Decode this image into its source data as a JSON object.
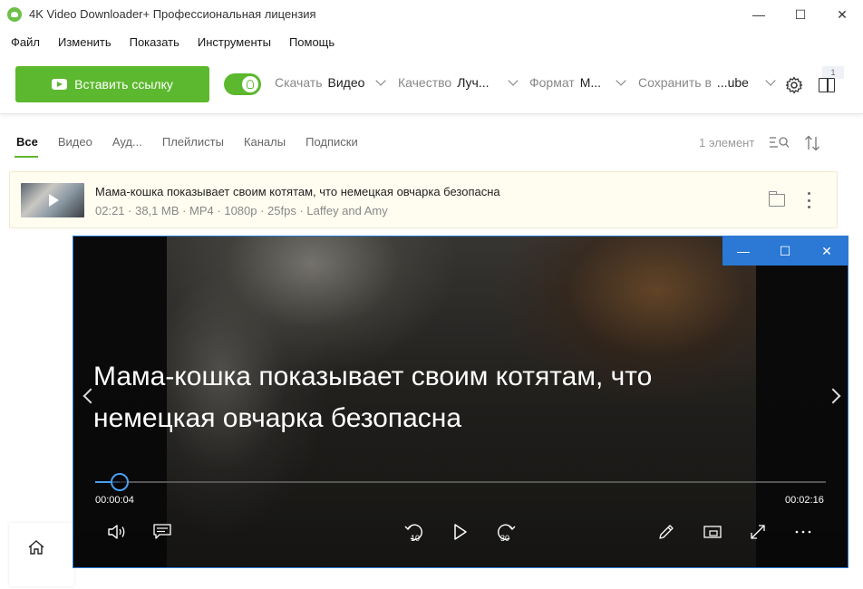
{
  "window": {
    "title": "4K Video Downloader+ Профессиональная лицензия",
    "controls": {
      "minimize": "—",
      "maximize": "☐",
      "close": "✕"
    }
  },
  "menu": [
    "Файл",
    "Изменить",
    "Показать",
    "Инструменты",
    "Помощь"
  ],
  "toolbar": {
    "paste_label": "Вставить ссылку",
    "smart_mode_on": true,
    "download_label": "Скачать",
    "download_value": "Видео",
    "quality_label": "Качество",
    "quality_value": "Луч...",
    "format_label": "Формат",
    "format_value": "M...",
    "save_label": "Сохранить в",
    "save_value": "...ube",
    "badge": "1"
  },
  "tabs": [
    "Все",
    "Видео",
    "Ауд...",
    "Плейлисты",
    "Каналы",
    "Подписки"
  ],
  "count": "1 элемент",
  "download_item": {
    "title": "Мама-кошка показывает своим котятам, что немецкая овчарка безопасна",
    "meta": "02:21 · 38,1 MB · MP4 · 1080p · 25fps · Laffey and Amy"
  },
  "player": {
    "title": "Мама-кошка показывает своим котятам, что немецкая овчарка безопасна",
    "current_time": "00:00:04",
    "total_time": "00:02:16",
    "progress": 0.033,
    "controls": {
      "minimize": "—",
      "maximize": "☐",
      "close": "✕"
    },
    "skip_back": "10",
    "skip_forward": "30"
  },
  "colors": {
    "accent": "#5cb82e",
    "player_accent": "#2b79d4",
    "seek": "#4a9ef0"
  }
}
